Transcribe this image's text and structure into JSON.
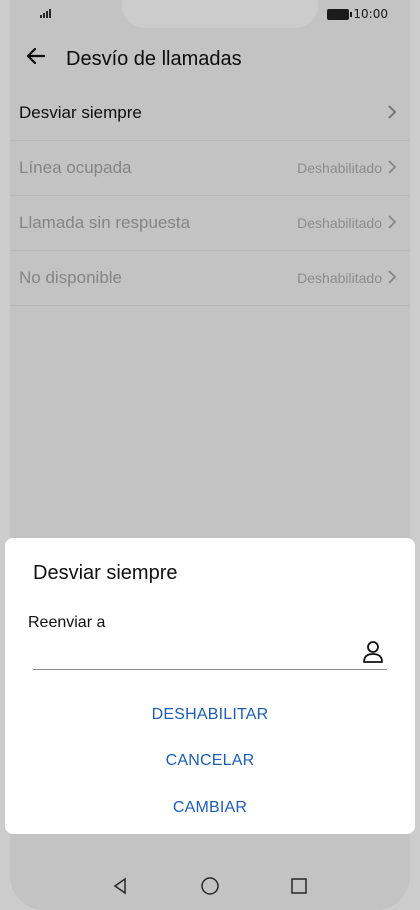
{
  "status": {
    "time": "10:00"
  },
  "header": {
    "title": "Desvío de llamadas"
  },
  "list": [
    {
      "label": "Desviar siempre",
      "value": "",
      "disabled": false
    },
    {
      "label": "Línea ocupada",
      "value": "Deshabilitado",
      "disabled": true
    },
    {
      "label": "Llamada sin respuesta",
      "value": "Deshabilitado",
      "disabled": true
    },
    {
      "label": "No disponible",
      "value": "Deshabilitado",
      "disabled": true
    }
  ],
  "dialog": {
    "title": "Desviar siempre",
    "field_label": "Reenviar a",
    "input_value": "",
    "buttons": {
      "disable": "DESHABILITAR",
      "cancel": "CANCELAR",
      "change": "CAMBIAR"
    }
  },
  "colors": {
    "accent": "#1d5eb4"
  },
  "icons": {
    "back": "back-arrow-icon",
    "chevron": "chevron-right-icon",
    "contact": "contact-icon",
    "nav_back": "nav-back-icon",
    "nav_home": "nav-home-icon",
    "nav_recent": "nav-recent-icon"
  }
}
